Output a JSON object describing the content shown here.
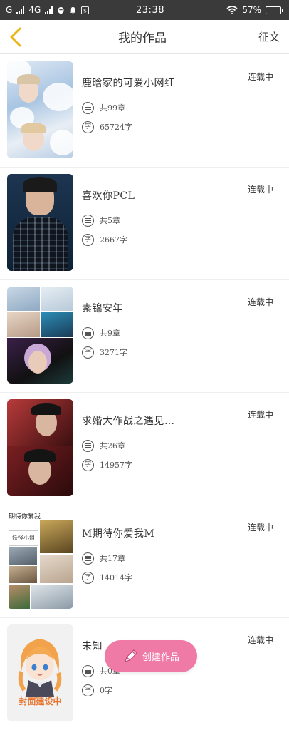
{
  "status_bar": {
    "carrier_left": "G",
    "network": "4G",
    "time": "23:38",
    "battery": "57%",
    "battery_level": 0.57,
    "icons": [
      "signal-icon",
      "signal-icon",
      "qq-icon",
      "notification-icon",
      "s-app-icon",
      "wifi-icon",
      "battery-icon"
    ]
  },
  "header": {
    "title": "我的作品",
    "action": "征文",
    "back_icon": "chevron-left-icon",
    "accent": "#e8b515"
  },
  "works": [
    {
      "title": "鹿晗家的可爱小网红",
      "status": "连载中",
      "chapters": "共99章",
      "words": "65724字"
    },
    {
      "title": "喜欢你PCL",
      "status": "连载中",
      "chapters": "共5章",
      "words": "2667字"
    },
    {
      "title": "素锦安年",
      "status": "连载中",
      "chapters": "共9章",
      "words": "3271字"
    },
    {
      "title": "求婚大作战之遇见…",
      "status": "连载中",
      "chapters": "共26章",
      "words": "14957字"
    },
    {
      "title": "M期待你爱我M",
      "status": "连载中",
      "chapters": "共17章",
      "words": "14014字",
      "cover_caption": "期待你爱我",
      "cover_tag": "妖怪小姐"
    },
    {
      "title": "未知",
      "status": "连载中",
      "chapters": "共0章",
      "words": "0字",
      "cover_caption": "封面建设中"
    }
  ],
  "icon_names": {
    "chapters": "list-icon",
    "words": "zi-icon"
  },
  "word_icon_glyph": "字",
  "fab": {
    "label": "创建作品",
    "icon": "pencil-icon",
    "color": "#f07aa6"
  }
}
